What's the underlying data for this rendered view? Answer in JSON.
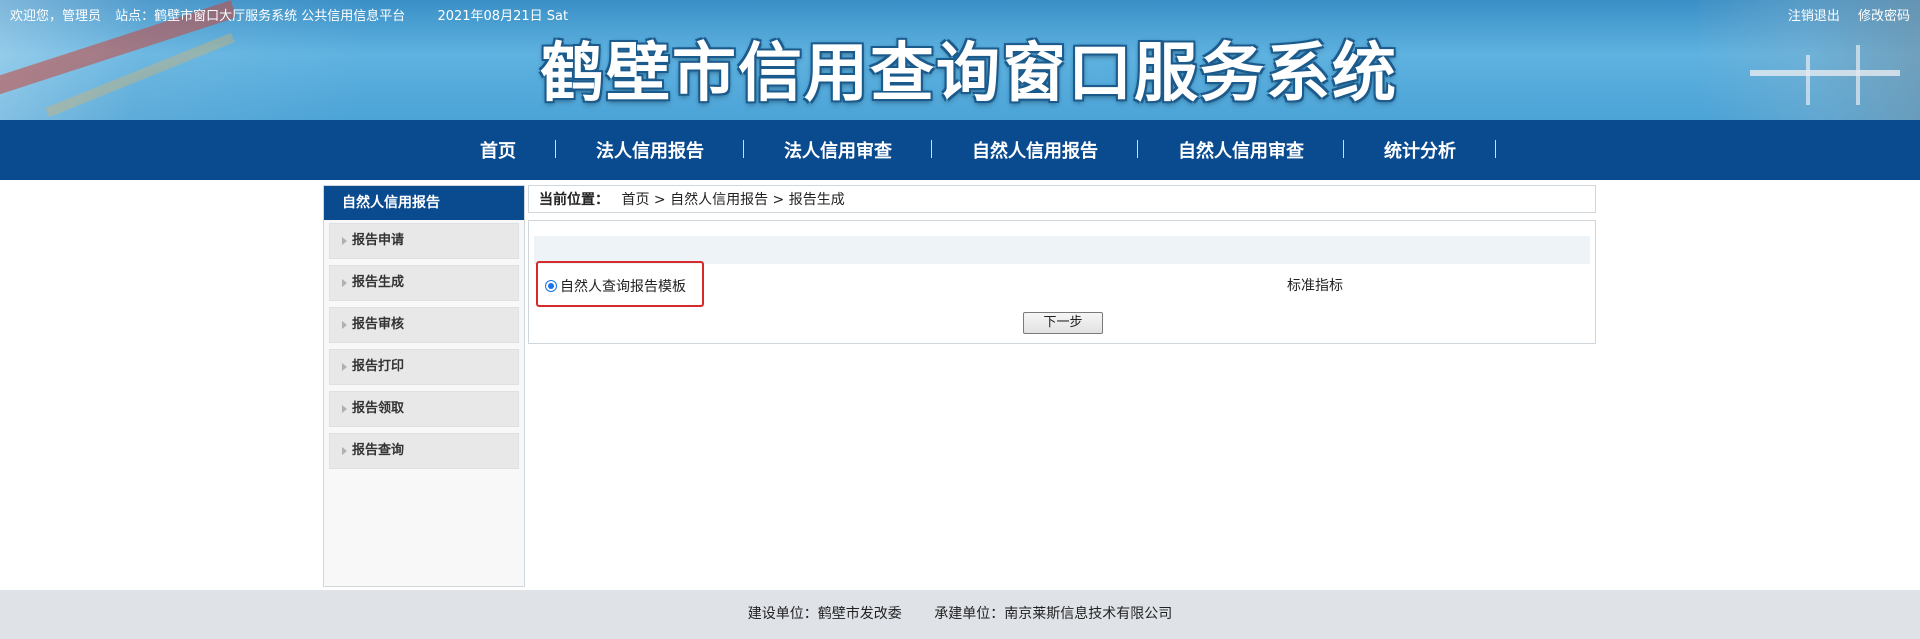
{
  "header": {
    "welcome": "欢迎您，管理员",
    "station": "站点：鹤壁市窗口大厅服务系统 公共信用信息平台",
    "date": "2021年08月21日 Sat",
    "links": [
      "注销退出",
      "修改密码"
    ],
    "title": "鹤壁市信用查询窗口服务系统"
  },
  "nav": {
    "items": [
      "首页",
      "法人信用报告",
      "法人信用审查",
      "自然人信用报告",
      "自然人信用审查",
      "统计分析"
    ]
  },
  "sidebar": {
    "title": "自然人信用报告",
    "items": [
      "报告申请",
      "报告生成",
      "报告审核",
      "报告打印",
      "报告领取",
      "报告查询"
    ]
  },
  "breadcrumb": {
    "label": "当前位置：",
    "path": "首页 > 自然人信用报告 > 报告生成"
  },
  "main": {
    "radio_label": "自然人查询报告模板",
    "radio_checked": true,
    "standard_label": "标准指标",
    "next_button": "下一步"
  },
  "footer": {
    "builder": "建设单位：鹤壁市发改委",
    "contractor": "承建单位：南京莱斯信息技术有限公司"
  },
  "colors": {
    "nav_bg": "#0a4a8f",
    "highlight": "#d62b2b",
    "footer_bg": "#dfe3e8"
  }
}
